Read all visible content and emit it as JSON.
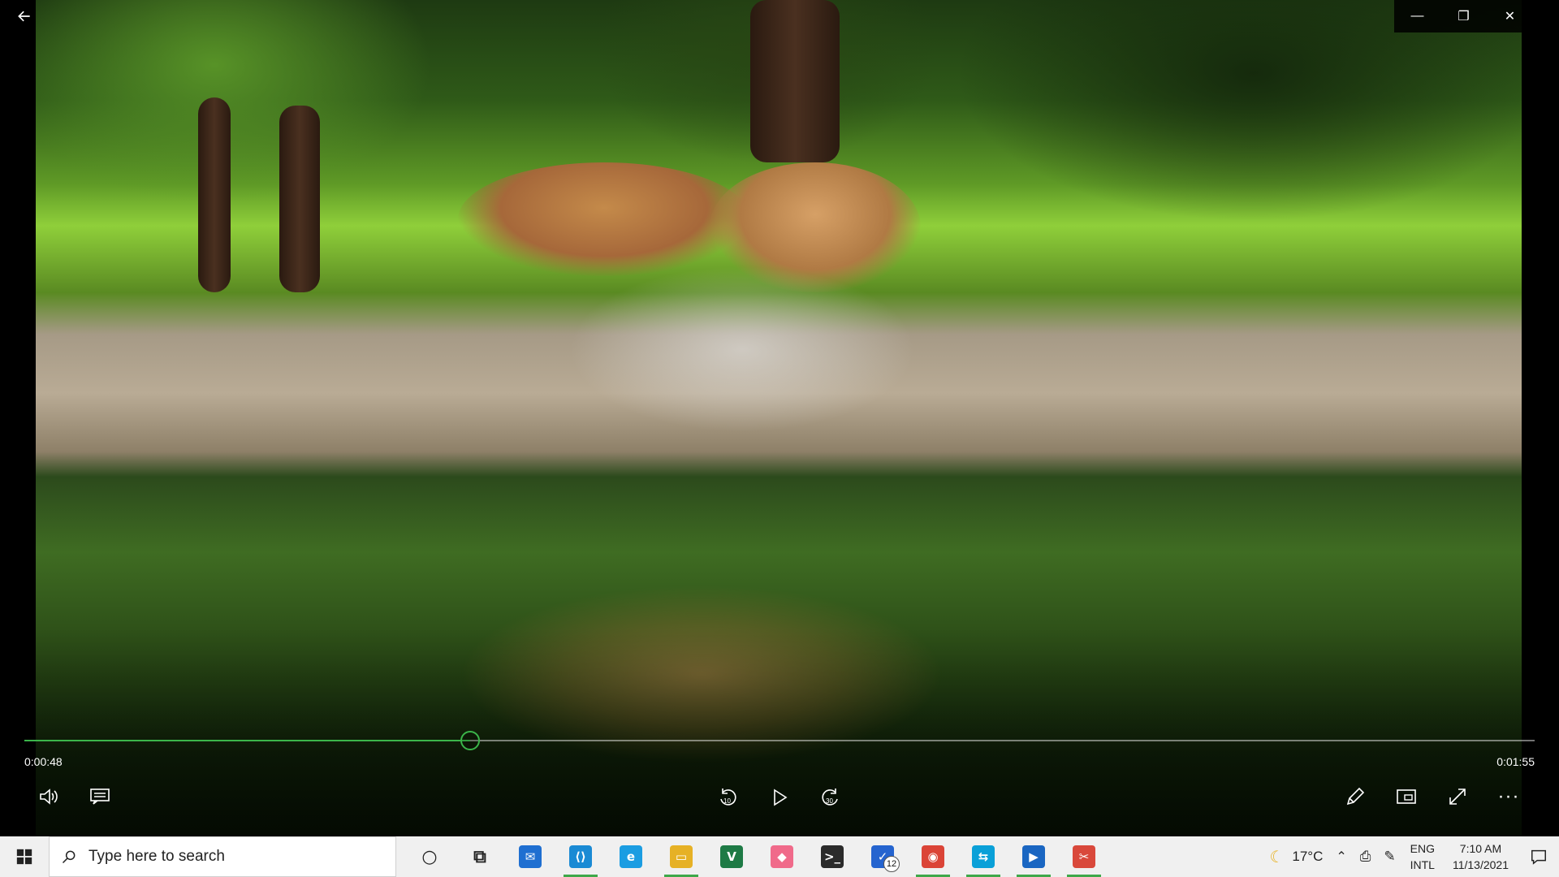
{
  "player": {
    "current_time": "0:00:48",
    "duration": "0:01:55",
    "progress": 0.295,
    "accent": "#3bb54a"
  },
  "titlebar": {
    "back_icon": "arrow-left-icon",
    "minimize": "—",
    "restore": "❐",
    "close": "✕"
  },
  "controls": {
    "volume": "volume-icon",
    "captions": "captions-icon",
    "skip_back_label": "10",
    "play": "play-icon",
    "skip_fwd_label": "30",
    "edit": "pencil-icon",
    "miniview": "mini-view-icon",
    "fullscreen": "fullscreen-icon",
    "more": "···"
  },
  "taskbar": {
    "search_placeholder": "Type here to search",
    "apps": [
      {
        "name": "cortana-icon",
        "color": "#222",
        "glyph": "○",
        "active": false
      },
      {
        "name": "task-view-icon",
        "color": "#222",
        "glyph": "⧉",
        "active": false
      },
      {
        "name": "mail-icon",
        "color": "#1f6fd1",
        "glyph": "✉",
        "active": false
      },
      {
        "name": "vscode-icon",
        "color": "#1a8ad4",
        "glyph": "⟨⟩",
        "active": true
      },
      {
        "name": "edge-icon",
        "color": "#1b9de2",
        "glyph": "e",
        "active": false
      },
      {
        "name": "file-explorer-icon",
        "color": "#e6b125",
        "glyph": "▭",
        "active": true
      },
      {
        "name": "excel-icon",
        "color": "#1e7a45",
        "glyph": "V",
        "active": false
      },
      {
        "name": "paint3d-icon",
        "color": "#f06a8a",
        "glyph": "◆",
        "active": false
      },
      {
        "name": "terminal-icon",
        "color": "#2b2b2b",
        "glyph": ">_",
        "active": false
      },
      {
        "name": "todo-icon",
        "color": "#2564cf",
        "glyph": "✓",
        "active": false,
        "badge": "12"
      },
      {
        "name": "chrome-icon",
        "color": "#db4437",
        "glyph": "◉",
        "active": true
      },
      {
        "name": "remote-icon",
        "color": "#0aa0d8",
        "glyph": "⇆",
        "active": true
      },
      {
        "name": "movies-tv-icon",
        "color": "#1a66c2",
        "glyph": "▶",
        "active": true
      },
      {
        "name": "snip-icon",
        "color": "#d9483b",
        "glyph": "✂",
        "active": true
      }
    ],
    "weather": "17°C",
    "lang_top": "ENG",
    "lang_bottom": "INTL",
    "time": "7:10 AM",
    "date": "11/13/2021"
  }
}
